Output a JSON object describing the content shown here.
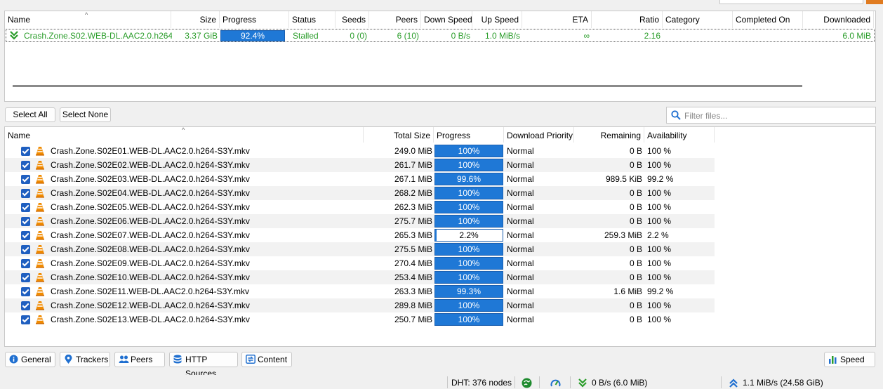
{
  "torrent_table": {
    "columns": [
      "Name",
      "Size",
      "Progress",
      "Status",
      "Seeds",
      "Peers",
      "Down Speed",
      "Up Speed",
      "ETA",
      "Ratio",
      "Category",
      "Completed On",
      "Downloaded"
    ],
    "row": {
      "name": "Crash.Zone.S02.WEB-DL.AAC2.0.h264...",
      "size": "3.37 GiB",
      "progress": "92.4%",
      "progress_value": 0.924,
      "status": "Stalled",
      "seeds": "0 (0)",
      "peers": "6 (10)",
      "down_speed": "0 B/s",
      "up_speed": "1.0 MiB/s",
      "eta": "∞",
      "ratio": "2.16",
      "category": "",
      "completed_on": "",
      "downloaded": "6.0 MiB"
    }
  },
  "file_toolbar": {
    "select_all": "Select All",
    "select_none": "Select None",
    "filter_placeholder": "Filter files..."
  },
  "file_table": {
    "columns": [
      "Name",
      "Total Size",
      "Progress",
      "Download Priority",
      "Remaining",
      "Availability"
    ],
    "rows": [
      {
        "name": "Crash.Zone.S02E01.WEB-DL.AAC2.0.h264-S3Y.mkv",
        "size": "249.0 MiB",
        "progress": "100%",
        "priority": "Normal",
        "remaining": "0 B",
        "availability": "100 %"
      },
      {
        "name": "Crash.Zone.S02E02.WEB-DL.AAC2.0.h264-S3Y.mkv",
        "size": "261.7 MiB",
        "progress": "100%",
        "priority": "Normal",
        "remaining": "0 B",
        "availability": "100 %"
      },
      {
        "name": "Crash.Zone.S02E03.WEB-DL.AAC2.0.h264-S3Y.mkv",
        "size": "267.1 MiB",
        "progress": "99.6%",
        "priority": "Normal",
        "remaining": "989.5 KiB",
        "availability": "99.2 %"
      },
      {
        "name": "Crash.Zone.S02E04.WEB-DL.AAC2.0.h264-S3Y.mkv",
        "size": "268.2 MiB",
        "progress": "100%",
        "priority": "Normal",
        "remaining": "0 B",
        "availability": "100 %"
      },
      {
        "name": "Crash.Zone.S02E05.WEB-DL.AAC2.0.h264-S3Y.mkv",
        "size": "262.3 MiB",
        "progress": "100%",
        "priority": "Normal",
        "remaining": "0 B",
        "availability": "100 %"
      },
      {
        "name": "Crash.Zone.S02E06.WEB-DL.AAC2.0.h264-S3Y.mkv",
        "size": "275.7 MiB",
        "progress": "100%",
        "priority": "Normal",
        "remaining": "0 B",
        "availability": "100 %"
      },
      {
        "name": "Crash.Zone.S02E07.WEB-DL.AAC2.0.h264-S3Y.mkv",
        "size": "265.3 MiB",
        "progress": "2.2%",
        "priority": "Normal",
        "remaining": "259.3 MiB",
        "availability": "2.2 %"
      },
      {
        "name": "Crash.Zone.S02E08.WEB-DL.AAC2.0.h264-S3Y.mkv",
        "size": "275.5 MiB",
        "progress": "100%",
        "priority": "Normal",
        "remaining": "0 B",
        "availability": "100 %"
      },
      {
        "name": "Crash.Zone.S02E09.WEB-DL.AAC2.0.h264-S3Y.mkv",
        "size": "270.4 MiB",
        "progress": "100%",
        "priority": "Normal",
        "remaining": "0 B",
        "availability": "100 %"
      },
      {
        "name": "Crash.Zone.S02E10.WEB-DL.AAC2.0.h264-S3Y.mkv",
        "size": "253.4 MiB",
        "progress": "100%",
        "priority": "Normal",
        "remaining": "0 B",
        "availability": "100 %"
      },
      {
        "name": "Crash.Zone.S02E11.WEB-DL.AAC2.0.h264-S3Y.mkv",
        "size": "263.3 MiB",
        "progress": "99.3%",
        "priority": "Normal",
        "remaining": "1.6 MiB",
        "availability": "99.2 %"
      },
      {
        "name": "Crash.Zone.S02E12.WEB-DL.AAC2.0.h264-S3Y.mkv",
        "size": "289.8 MiB",
        "progress": "100%",
        "priority": "Normal",
        "remaining": "0 B",
        "availability": "100 %"
      },
      {
        "name": "Crash.Zone.S02E13.WEB-DL.AAC2.0.h264-S3Y.mkv",
        "size": "250.7 MiB",
        "progress": "100%",
        "priority": "Normal",
        "remaining": "0 B",
        "availability": "100 %"
      }
    ]
  },
  "tabs": [
    "General",
    "Trackers",
    "Peers",
    "HTTP Sources",
    "Content"
  ],
  "speed_button": "Speed",
  "status_bar": {
    "dht": "DHT: 376 nodes",
    "down": "0 B/s (6.0 MiB)",
    "up": "1.1 MiB/s (24.58 GiB)"
  },
  "colors": {
    "accent": "#1f78d6",
    "torrent_text": "#2a9d2a"
  }
}
